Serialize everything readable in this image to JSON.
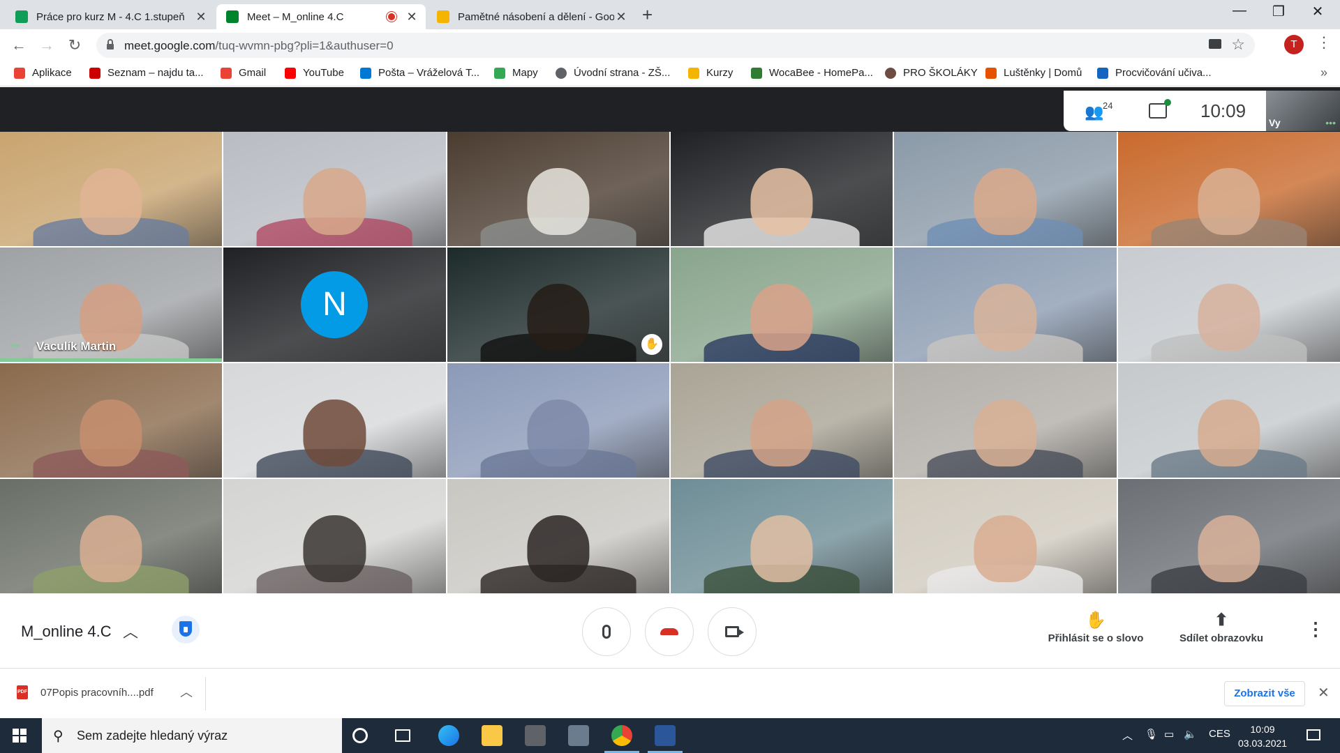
{
  "browser": {
    "tabs": [
      {
        "title": "Práce pro kurz M - 4.C 1.stupeň",
        "close": "✕",
        "favicon_color": "#0f9d58"
      },
      {
        "title": "Meet – M_online 4.C",
        "close": "✕",
        "favicon_color": "#00832d",
        "recording": true
      },
      {
        "title": "Pamětné násobení a dělení - Goo",
        "close": "✕",
        "favicon_color": "#f4b400"
      }
    ],
    "new_tab": "+",
    "window_controls": {
      "minimize": "—",
      "maximize": "❐",
      "close": "✕"
    },
    "nav": {
      "back": "←",
      "forward": "→",
      "reload": "↻"
    },
    "url": {
      "host": "meet.google.com",
      "path": "/tuq-wvmn-pbg?pli=1&authuser=0"
    },
    "profile_initial": "T",
    "menu_icon": "⋮",
    "bookmarks": [
      {
        "label": "Aplikace",
        "color": "#ea4335"
      },
      {
        "label": "Seznam – najdu ta...",
        "color": "#cc0000"
      },
      {
        "label": "Gmail",
        "color": "#ea4335"
      },
      {
        "label": "YouTube",
        "color": "#ff0000"
      },
      {
        "label": "Pošta – Vráželová T...",
        "color": "#0078d4"
      },
      {
        "label": "Mapy",
        "color": "#34a853"
      },
      {
        "label": "Úvodní strana - ZŠ...",
        "color": "#5f6368"
      },
      {
        "label": "Kurzy",
        "color": "#f4b400"
      },
      {
        "label": "WocaBee - HomePa...",
        "color": "#2e7d32"
      },
      {
        "label": "PRO ŠKOLÁKY",
        "color": "#6d4c41"
      },
      {
        "label": "Luštěnky | Domů",
        "color": "#e65100"
      },
      {
        "label": "Procvičování učiva...",
        "color": "#1565c0"
      }
    ],
    "bookmarks_more": "»"
  },
  "meet": {
    "participant_count": "24",
    "time": "10:09",
    "self_label": "Vy",
    "meeting_title": "M_online 4.C",
    "active_speaker": "Vaculík Martin",
    "tiles": [
      {
        "bg": "#c9a46f",
        "skin": "#e0b494",
        "shirt": "#6a7d9e"
      },
      {
        "bg": "#b9bcc3",
        "skin": "#d8a88a",
        "shirt": "#b04b64"
      },
      {
        "bg": "#4b3c30",
        "skin": "#e8e5de",
        "shirt": "#8a8d8c"
      },
      {
        "bg": "#202124",
        "skin": "#e6c2a4",
        "shirt": "#e9e9e9"
      },
      {
        "bg": "#8b9aa8",
        "skin": "#d9a98a",
        "shirt": "#6f8fb4"
      },
      {
        "bg": "#c96a2d",
        "skin": "#d8b094",
        "shirt": "#9a8474"
      },
      {
        "bg": "#9fa2a5",
        "skin": "#d59f83",
        "shirt": "#c8c8c8"
      },
      {
        "bg": "#202124",
        "avatar": "N"
      },
      {
        "bg": "#1d2a2a",
        "skin": "#241c16",
        "shirt": "#111111",
        "hand": true
      },
      {
        "bg": "#89a58c",
        "skin": "#d9a28a",
        "shirt": "#2b3b60"
      },
      {
        "bg": "#8c9cb2",
        "skin": "#d8b39a",
        "shirt": "#c8c4c0"
      },
      {
        "bg": "#c8ccd0",
        "skin": "#d7b29e",
        "shirt": "#bfbfbf"
      },
      {
        "bg": "#8a6a4c",
        "skin": "#c58e6f",
        "shirt": "#8d5a5a"
      },
      {
        "bg": "#d6d8da",
        "skin": "#6e4a3a",
        "shirt": "#404a5a"
      },
      {
        "bg": "#8c9ab8",
        "skin": "#7e8aa8",
        "shirt": "#6b7896"
      },
      {
        "bg": "#a9a495",
        "skin": "#d4a388",
        "shirt": "#3d4b63"
      },
      {
        "bg": "#b2aea8",
        "skin": "#d8b094",
        "shirt": "#4a4f5a"
      },
      {
        "bg": "#c5c9cc",
        "skin": "#d6ab8e",
        "shirt": "#6a7a88"
      },
      {
        "bg": "#6a6f66",
        "skin": "#d8ae92",
        "shirt": "#8ea06a"
      },
      {
        "bg": "#d4d4d2",
        "skin": "#3a3533",
        "shirt": "#6a6262"
      },
      {
        "bg": "#c9c7c2",
        "skin": "#2b2624",
        "shirt": "#2b2624"
      },
      {
        "bg": "#6e8d96",
        "skin": "#e1bea3",
        "shirt": "#3a4f3a"
      },
      {
        "bg": "#d1cbbf",
        "skin": "#d9ad92",
        "shirt": "#e8e8e8"
      },
      {
        "bg": "#6b6f74",
        "skin": "#d9b29a",
        "shirt": "#3b3d42"
      }
    ],
    "controls": {
      "raise_hand_label": "Přihlásit se o slovo",
      "present_label": "Sdílet obrazovku"
    }
  },
  "downloads": {
    "file_name": "07Popis pracovníh....pdf",
    "file_type": "PDF",
    "show_all_label": "Zobrazit vše"
  },
  "taskbar": {
    "search_placeholder": "Sem zadejte hledaný výraz",
    "lang": "CES",
    "clock_time": "10:09",
    "clock_date": "03.03.2021"
  }
}
